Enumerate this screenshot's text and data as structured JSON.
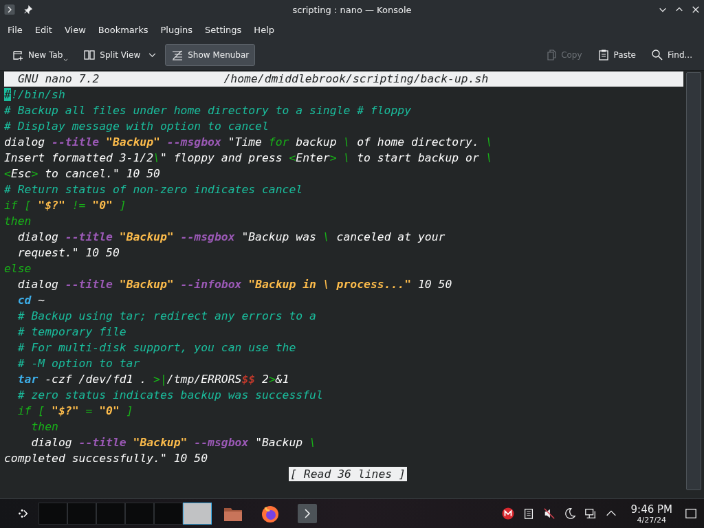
{
  "window": {
    "title": "scripting : nano — Konsole"
  },
  "menubar": [
    "File",
    "Edit",
    "View",
    "Bookmarks",
    "Plugins",
    "Settings",
    "Help"
  ],
  "toolbar": {
    "left": [
      {
        "kind": "newtab",
        "label": "New Tab",
        "checked": false,
        "disabled": false
      },
      {
        "kind": "split",
        "label": "Split View",
        "checked": false,
        "disabled": false
      },
      {
        "kind": "menubar",
        "label": "Show Menubar",
        "checked": true,
        "disabled": false
      }
    ],
    "right": [
      {
        "kind": "copy",
        "label": "Copy",
        "checked": false,
        "disabled": true
      },
      {
        "kind": "paste",
        "label": "Paste",
        "checked": false,
        "disabled": false
      },
      {
        "kind": "find",
        "label": "Find...",
        "checked": false,
        "disabled": false
      }
    ]
  },
  "nano": {
    "title": "GNU nano 7.2",
    "path": "/home/dmiddlebrook/scripting/back-up.sh",
    "lines": [
      [
        {
          "kind": "cursor",
          "text": "#"
        },
        {
          "kind": "comment",
          "text": "!/bin/sh"
        }
      ],
      [
        {
          "kind": "comment",
          "text": "# Backup all files under home directory to a single # floppy"
        }
      ],
      [
        {
          "kind": "comment",
          "text": "# Display message with option to cancel"
        }
      ],
      [
        {
          "kind": "plain",
          "text": "dialog "
        },
        {
          "kind": "option",
          "text": "--title"
        },
        {
          "kind": "string",
          "text": " \"Backup\""
        },
        {
          "kind": "option",
          "text": " --msgbox"
        },
        {
          "kind": "plain",
          "text": " \"Time "
        },
        {
          "kind": "keyword",
          "text": "for"
        },
        {
          "kind": "plain",
          "text": " backup "
        },
        {
          "kind": "keyword",
          "text": "\\"
        },
        {
          "kind": "plain",
          "text": " of home directory. "
        },
        {
          "kind": "keyword",
          "text": "\\"
        }
      ],
      [
        {
          "kind": "plain",
          "text": "Insert formatted 3-1/2"
        },
        {
          "kind": "keyword",
          "text": "\\"
        },
        {
          "kind": "plain",
          "text": "\" floppy and press "
        },
        {
          "kind": "keyword",
          "text": "<"
        },
        {
          "kind": "plain",
          "text": "Enter"
        },
        {
          "kind": "keyword",
          "text": "> \\"
        },
        {
          "kind": "plain",
          "text": " to start backup or "
        },
        {
          "kind": "keyword",
          "text": "\\"
        }
      ],
      [
        {
          "kind": "keyword",
          "text": "<"
        },
        {
          "kind": "plain",
          "text": "Esc"
        },
        {
          "kind": "keyword",
          "text": ">"
        },
        {
          "kind": "plain",
          "text": " to cancel.\" 10 50"
        }
      ],
      [
        {
          "kind": "comment",
          "text": "# Return status of non-zero indicates cancel"
        }
      ],
      [
        {
          "kind": "keyword",
          "text": "if [ "
        },
        {
          "kind": "string",
          "text": "\"$?\""
        },
        {
          "kind": "keyword",
          "text": " != "
        },
        {
          "kind": "string",
          "text": "\"0\""
        },
        {
          "kind": "keyword",
          "text": " ]"
        }
      ],
      [
        {
          "kind": "keyword",
          "text": "then"
        }
      ],
      [
        {
          "kind": "plain",
          "text": "  dialog "
        },
        {
          "kind": "option",
          "text": "--title"
        },
        {
          "kind": "string",
          "text": " \"Backup\""
        },
        {
          "kind": "option",
          "text": " --msgbox"
        },
        {
          "kind": "plain",
          "text": " \"Backup was "
        },
        {
          "kind": "keyword",
          "text": "\\"
        },
        {
          "kind": "plain",
          "text": " canceled at your"
        }
      ],
      [
        {
          "kind": "plain",
          "text": "  request.\" 10 50"
        }
      ],
      [
        {
          "kind": "keyword",
          "text": "else"
        }
      ],
      [
        {
          "kind": "plain",
          "text": "  dialog "
        },
        {
          "kind": "option",
          "text": "--title"
        },
        {
          "kind": "string",
          "text": " \"Backup\""
        },
        {
          "kind": "option",
          "text": " --infobox"
        },
        {
          "kind": "string",
          "text": " \"Backup in \\ process...\""
        },
        {
          "kind": "plain",
          "text": " 10 50"
        }
      ],
      [
        {
          "kind": "builtin",
          "text": "  cd"
        },
        {
          "kind": "plain",
          "text": " ~"
        }
      ],
      [
        {
          "kind": "comment",
          "text": "  # Backup using tar; redirect any errors to a"
        }
      ],
      [
        {
          "kind": "comment",
          "text": "  # temporary file"
        }
      ],
      [
        {
          "kind": "comment",
          "text": "  # For multi-disk support, you can use the"
        }
      ],
      [
        {
          "kind": "comment",
          "text": "  # -M option to tar"
        }
      ],
      [
        {
          "kind": "builtin",
          "text": "  tar"
        },
        {
          "kind": "plain",
          "text": " -czf /dev/fd1 . "
        },
        {
          "kind": "keyword",
          "text": ">|"
        },
        {
          "kind": "plain",
          "text": "/tmp/ERRORS"
        },
        {
          "kind": "variable",
          "text": "$$"
        },
        {
          "kind": "plain",
          "text": " 2"
        },
        {
          "kind": "keyword",
          "text": ">"
        },
        {
          "kind": "plain",
          "text": "&1"
        }
      ],
      [
        {
          "kind": "comment",
          "text": "  # zero status indicates backup was successful"
        }
      ],
      [
        {
          "kind": "keyword",
          "text": "  if [ "
        },
        {
          "kind": "string",
          "text": "\"$?\""
        },
        {
          "kind": "keyword",
          "text": " = "
        },
        {
          "kind": "string",
          "text": "\"0\""
        },
        {
          "kind": "keyword",
          "text": " ]"
        }
      ],
      [
        {
          "kind": "keyword",
          "text": "    then"
        }
      ],
      [
        {
          "kind": "plain",
          "text": "    dialog "
        },
        {
          "kind": "option",
          "text": "--title"
        },
        {
          "kind": "string",
          "text": " \"Backup\""
        },
        {
          "kind": "option",
          "text": " --msgbox"
        },
        {
          "kind": "plain",
          "text": " \"Backup "
        },
        {
          "kind": "keyword",
          "text": "\\"
        }
      ],
      [
        {
          "kind": "plain",
          "text": "completed successfully.\" 10 50"
        }
      ]
    ],
    "status": "[ Read 36 lines ]"
  },
  "taskbar": {
    "pager": [
      {
        "selected": false
      },
      {
        "selected": false
      },
      {
        "selected": false
      },
      {
        "selected": false
      },
      {
        "selected": false
      },
      {
        "selected": true
      }
    ],
    "apps": [
      {
        "kind": "folder"
      },
      {
        "kind": "firefox"
      },
      {
        "kind": "terminal"
      }
    ],
    "tray": [
      {
        "kind": "mega"
      },
      {
        "kind": "clipboard"
      },
      {
        "kind": "muted"
      },
      {
        "kind": "weather"
      },
      {
        "kind": "network"
      },
      {
        "kind": "expand"
      }
    ],
    "time": "9:46 PM",
    "date": "4/27/24"
  }
}
